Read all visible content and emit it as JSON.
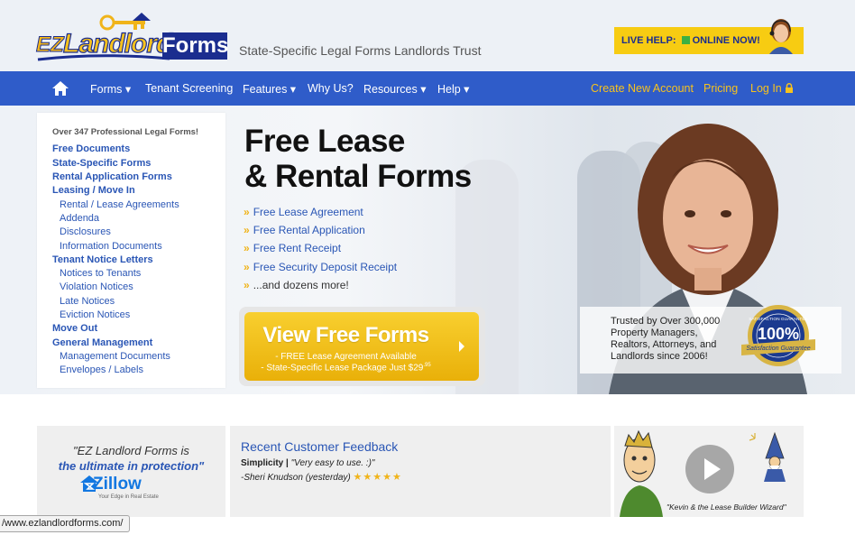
{
  "header": {
    "logo": {
      "ez": "EZ",
      "landlord": "Landlord",
      "forms": "Forms"
    },
    "tagline": "State-Specific Legal Forms Landlords Trust",
    "live_help": {
      "label": "LIVE HELP:",
      "status": "ONLINE NOW!"
    }
  },
  "nav": {
    "items": [
      {
        "label": "Forms ▾"
      },
      {
        "label": "Tenant Screening"
      },
      {
        "label": "Features ▾"
      },
      {
        "label": "Why Us?"
      },
      {
        "label": "Resources ▾"
      },
      {
        "label": "Help ▾"
      }
    ],
    "right": {
      "create_account": "Create New Account",
      "pricing": "Pricing",
      "login": "Log In"
    }
  },
  "sidebar": {
    "heading": "Over 347 Professional Legal Forms!",
    "links": [
      {
        "label": "Free Documents",
        "level": "main"
      },
      {
        "label": "State-Specific Forms",
        "level": "main"
      },
      {
        "label": "Rental Application Forms",
        "level": "main"
      },
      {
        "label": "Leasing / Move In",
        "level": "main"
      },
      {
        "label": "Rental / Lease Agreements",
        "level": "sub"
      },
      {
        "label": "Addenda",
        "level": "sub"
      },
      {
        "label": "Disclosures",
        "level": "sub"
      },
      {
        "label": "Information Documents",
        "level": "sub"
      },
      {
        "label": "Tenant Notice Letters",
        "level": "main"
      },
      {
        "label": "Notices to Tenants",
        "level": "sub"
      },
      {
        "label": "Violation Notices",
        "level": "sub"
      },
      {
        "label": "Late Notices",
        "level": "sub"
      },
      {
        "label": "Eviction Notices",
        "level": "sub"
      },
      {
        "label": "Move Out",
        "level": "main"
      },
      {
        "label": "General Management",
        "level": "main"
      },
      {
        "label": "Management Documents",
        "level": "sub"
      },
      {
        "label": "Envelopes / Labels",
        "level": "sub"
      }
    ]
  },
  "hero": {
    "title_line1": "Free Lease",
    "title_line2": "& Rental Forms",
    "bullets": [
      "Free Lease Agreement",
      "Free Rental Application",
      "Free Rent Receipt",
      "Free Security Deposit Receipt",
      "...and dozens more!"
    ],
    "cta": {
      "title": "View Free Forms",
      "line1": "- FREE Lease Agreement Available",
      "line2": "- State-Specific Lease Package Just $29",
      "cents": ".95"
    },
    "trust": [
      "Trusted by Over 300,000",
      "Property Managers,",
      "Realtors, Attorneys, and",
      "Landlords since 2006!"
    ],
    "seal": {
      "top": "SATISFACTION GUARANTEE",
      "pct": "100%",
      "band": "Satisfaction Guarantee"
    }
  },
  "testimonial": {
    "quote1": "\"EZ Landlord Forms is",
    "quote2": "the ultimate in protection\"",
    "brand": "Zillow",
    "brand_tag": "Your Edge in Real Estate"
  },
  "feedback": {
    "title": "Recent Customer Feedback",
    "subject": "Simplicity |",
    "comment": " \"Very easy to use. :)\"",
    "author": "-Sheri Knudson (yesterday)",
    "stars": "★★★★★"
  },
  "video": {
    "caption": "\"Kevin & the Lease Builder Wizard\""
  },
  "status_bar": {
    "url": "/www.ezlandlordforms.com/"
  },
  "colors": {
    "nav_blue": "#2f5cc9",
    "link_blue": "#2a56b5",
    "gold": "#f7c21d"
  }
}
